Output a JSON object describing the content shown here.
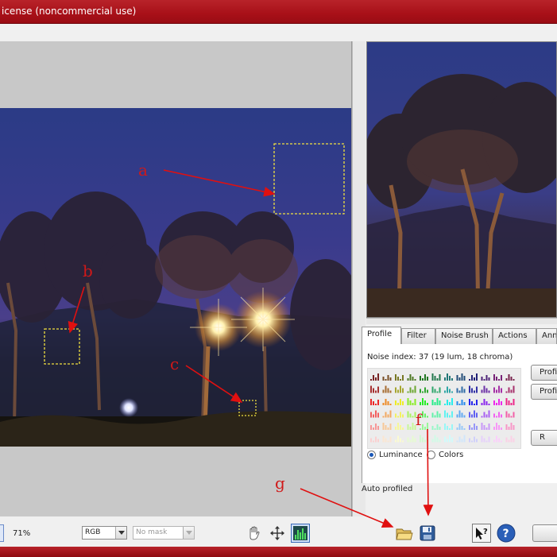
{
  "window": {
    "title": "icense (noncommercial use)"
  },
  "tabs": [
    {
      "label": "Profile",
      "active": true
    },
    {
      "label": "Filter",
      "active": false
    },
    {
      "label": "Noise Brush",
      "active": false
    },
    {
      "label": "Actions",
      "active": false
    },
    {
      "label": "Ann",
      "active": false
    }
  ],
  "profile_panel": {
    "noise_index": "Noise index:  37 (19 lum, 18 chroma)",
    "side_buttons": [
      "Profi",
      "Profi",
      "R"
    ],
    "radio_luminance": "Luminance",
    "radio_colors": "Colors",
    "selected_mode": "Luminance"
  },
  "status": {
    "auto_profiled": "Auto profiled"
  },
  "toolbar": {
    "zoom": "71%",
    "color_space": "RGB",
    "mask": "No mask",
    "icons": [
      "hand-icon",
      "move-icon",
      "histogram-icon",
      "open-folder-icon",
      "save-icon",
      "help-pointer-icon",
      "help-icon"
    ]
  },
  "annotations": {
    "a": "a",
    "b": "b",
    "c": "c",
    "f": "f",
    "g": "g"
  },
  "colors": {
    "title_bar": "#a81018",
    "annotation": "#d01818",
    "selection_box": "#f0e040"
  }
}
